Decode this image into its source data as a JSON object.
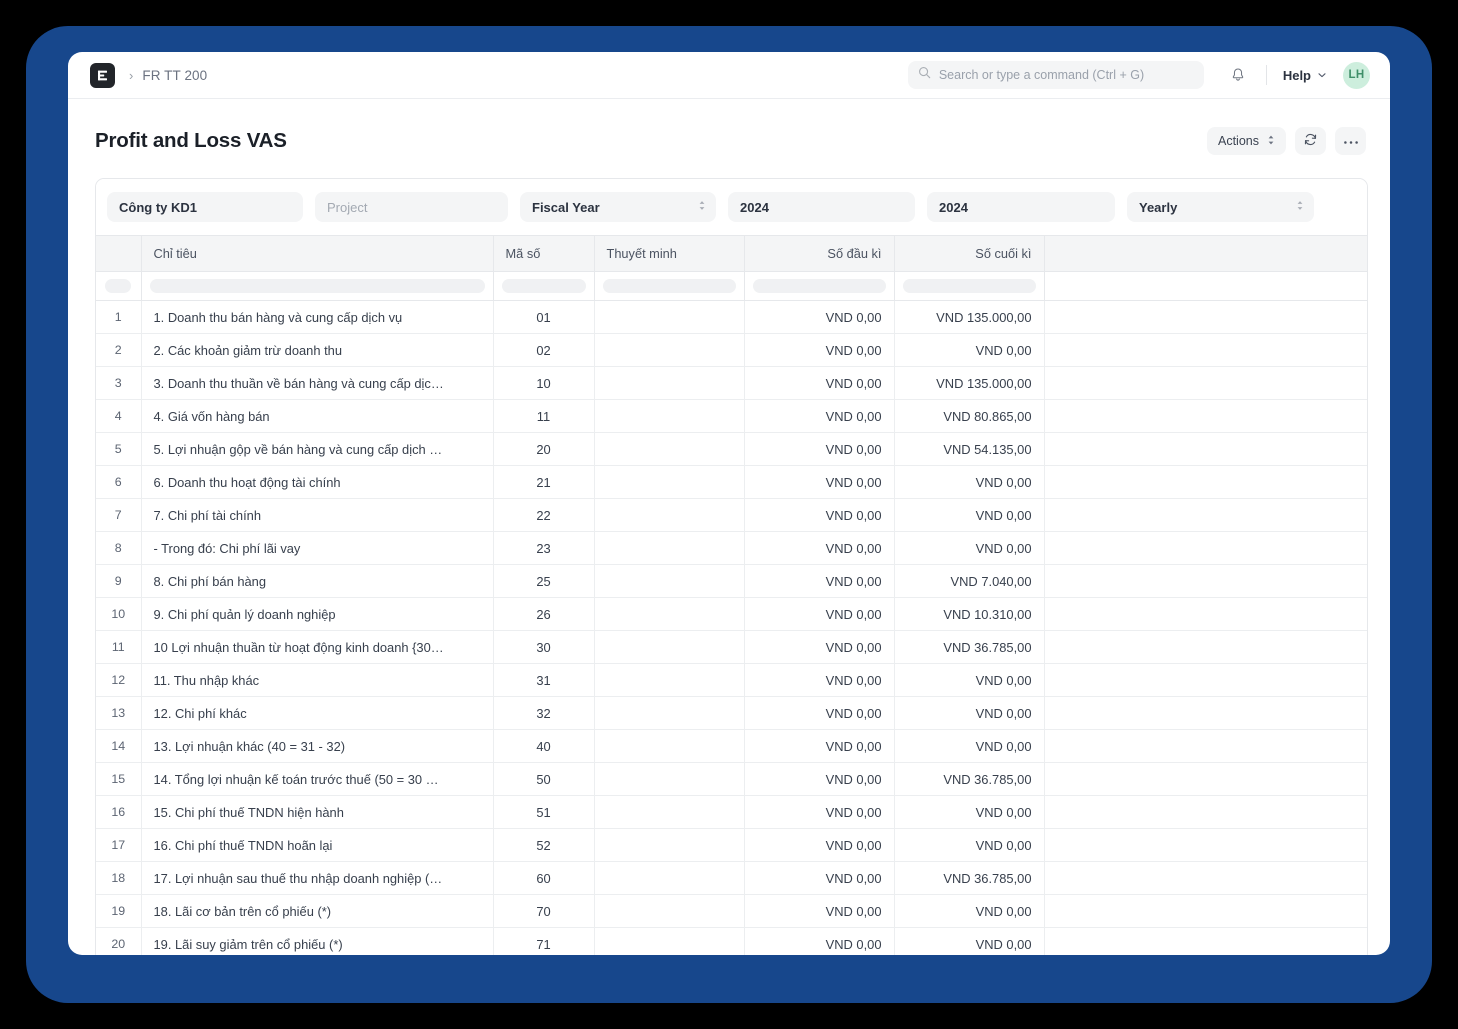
{
  "window": {
    "frame_color": "#17478c",
    "background": "#000000"
  },
  "navbar": {
    "logo_icon": "erpnext-logo-icon",
    "breadcrumb_separator": "›",
    "breadcrumb": "FR TT 200",
    "search": {
      "icon": "search-icon",
      "placeholder": "Search or type a command (Ctrl + G)",
      "value": ""
    },
    "notifications_icon": "bell-icon",
    "help_label": "Help",
    "help_caret_icon": "chevron-down-icon",
    "avatar_initials": "LH",
    "avatar_bg": "#cdeedd",
    "avatar_fg": "#3f8f69"
  },
  "page": {
    "title": "Profit and Loss VAS",
    "actions_label": "Actions",
    "actions_caret_icon": "select-caret-icon",
    "refresh_icon": "refresh-icon",
    "more_icon": "ellipsis-icon"
  },
  "filters": [
    {
      "name": "company",
      "value": "Công ty KD1",
      "placeholder": "",
      "type": "link",
      "caret": false
    },
    {
      "name": "project",
      "value": "",
      "placeholder": "Project",
      "type": "link",
      "caret": false
    },
    {
      "name": "period-basis",
      "value": "Fiscal Year",
      "placeholder": "",
      "type": "select",
      "caret": true
    },
    {
      "name": "from-fiscal-year",
      "value": "2024",
      "placeholder": "",
      "type": "link",
      "caret": false
    },
    {
      "name": "to-fiscal-year",
      "value": "2024",
      "placeholder": "",
      "type": "link",
      "caret": false
    },
    {
      "name": "periodicity",
      "value": "Yearly",
      "placeholder": "",
      "type": "select",
      "caret": true
    }
  ],
  "table": {
    "columns": [
      {
        "key": "idx",
        "label": "",
        "align": "center"
      },
      {
        "key": "name",
        "label": "Chỉ tiêu",
        "align": "left"
      },
      {
        "key": "code",
        "label": "Mã số",
        "align": "left"
      },
      {
        "key": "note",
        "label": "Thuyết minh",
        "align": "left"
      },
      {
        "key": "open",
        "label": "Số đầu kì",
        "align": "right"
      },
      {
        "key": "close",
        "label": "Số cuối kì",
        "align": "right"
      },
      {
        "key": "fill",
        "label": "",
        "align": "left"
      }
    ],
    "rows": [
      {
        "idx": "1",
        "name": "1. Doanh thu bán hàng và cung cấp dịch vụ",
        "code": "01",
        "note": "",
        "open": "VND 0,00",
        "close": "VND 135.000,00"
      },
      {
        "idx": "2",
        "name": "2. Các khoản giảm trừ doanh thu",
        "code": "02",
        "note": "",
        "open": "VND 0,00",
        "close": "VND 0,00"
      },
      {
        "idx": "3",
        "name": "3. Doanh thu thuần về bán hàng và cung cấp dịc…",
        "code": "10",
        "note": "",
        "open": "VND 0,00",
        "close": "VND 135.000,00"
      },
      {
        "idx": "4",
        "name": "4. Giá vốn hàng bán",
        "code": "11",
        "note": "",
        "open": "VND 0,00",
        "close": "VND 80.865,00"
      },
      {
        "idx": "5",
        "name": "5. Lợi nhuận gộp về bán hàng và cung cấp dịch …",
        "code": "20",
        "note": "",
        "open": "VND 0,00",
        "close": "VND 54.135,00"
      },
      {
        "idx": "6",
        "name": "6. Doanh thu hoạt động tài chính",
        "code": "21",
        "note": "",
        "open": "VND 0,00",
        "close": "VND 0,00"
      },
      {
        "idx": "7",
        "name": "7. Chi phí tài chính",
        "code": "22",
        "note": "",
        "open": "VND 0,00",
        "close": "VND 0,00"
      },
      {
        "idx": "8",
        "name": "  - Trong đó: Chi phí lãi vay",
        "code": "23",
        "note": "",
        "open": "VND 0,00",
        "close": "VND 0,00"
      },
      {
        "idx": "9",
        "name": "8. Chi phí bán hàng",
        "code": "25",
        "note": "",
        "open": "VND 0,00",
        "close": "VND 7.040,00"
      },
      {
        "idx": "10",
        "name": "9. Chi phí quản lý doanh nghiệp",
        "code": "26",
        "note": "",
        "open": "VND 0,00",
        "close": "VND 10.310,00"
      },
      {
        "idx": "11",
        "name": "10 Lợi nhuận thuần từ hoạt động kinh doanh {30…",
        "code": "30",
        "note": "",
        "open": "VND 0,00",
        "close": "VND 36.785,00"
      },
      {
        "idx": "12",
        "name": "11. Thu nhập khác",
        "code": "31",
        "note": "",
        "open": "VND 0,00",
        "close": "VND 0,00"
      },
      {
        "idx": "13",
        "name": "12. Chi phí khác",
        "code": "32",
        "note": "",
        "open": "VND 0,00",
        "close": "VND 0,00"
      },
      {
        "idx": "14",
        "name": "13. Lợi nhuận khác (40 = 31 - 32)",
        "code": "40",
        "note": "",
        "open": "VND 0,00",
        "close": "VND 0,00"
      },
      {
        "idx": "15",
        "name": "14. Tổng lợi nhuận kế toán trước thuế (50 = 30 …",
        "code": "50",
        "note": "",
        "open": "VND 0,00",
        "close": "VND 36.785,00"
      },
      {
        "idx": "16",
        "name": "15. Chi phí thuế TNDN hiện hành",
        "code": "51",
        "note": "",
        "open": "VND 0,00",
        "close": "VND 0,00"
      },
      {
        "idx": "17",
        "name": "16. Chi phí thuế TNDN hoãn lại",
        "code": "52",
        "note": "",
        "open": "VND 0,00",
        "close": "VND 0,00"
      },
      {
        "idx": "18",
        "name": "17. Lợi nhuận sau thuế thu nhập doanh nghiệp (…",
        "code": "60",
        "note": "",
        "open": "VND 0,00",
        "close": "VND 36.785,00"
      },
      {
        "idx": "19",
        "name": "18. Lãi cơ bản trên cổ phiếu (*)",
        "code": "70",
        "note": "",
        "open": "VND 0,00",
        "close": "VND 0,00"
      },
      {
        "idx": "20",
        "name": "19. Lãi suy giảm trên cổ phiếu (*)",
        "code": "71",
        "note": "",
        "open": "VND 0,00",
        "close": "VND 0,00"
      }
    ]
  }
}
